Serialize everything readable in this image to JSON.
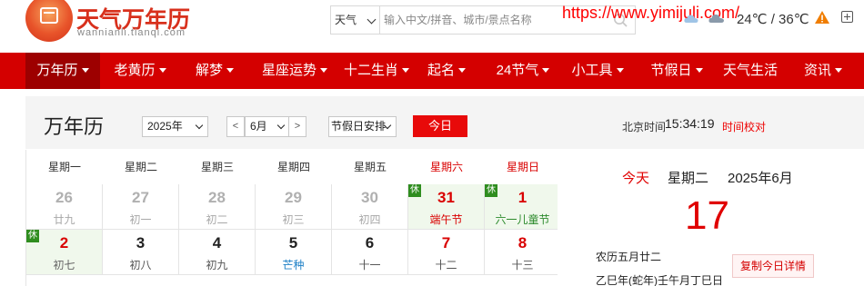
{
  "logo": {
    "title": "天气万年历",
    "subtitle": "wannianli.tianqi.com"
  },
  "search": {
    "type_selected": "天气",
    "placeholder": "输入中文/拼音、城市/景点名称"
  },
  "watermark": "https://www.yimijuli.com/",
  "weather": {
    "temp": "24℃ / 36℃"
  },
  "nav": [
    {
      "label": "万年历",
      "dropdown": true,
      "active": true
    },
    {
      "label": "老黄历",
      "dropdown": true
    },
    {
      "label": "解梦",
      "dropdown": true
    },
    {
      "label": "星座运势",
      "dropdown": true
    },
    {
      "label": "十二生肖",
      "dropdown": true
    },
    {
      "label": "起名",
      "dropdown": true
    },
    {
      "label": "24节气",
      "dropdown": true
    },
    {
      "label": "小工具",
      "dropdown": true
    },
    {
      "label": "节假日",
      "dropdown": true
    },
    {
      "label": "天气生活",
      "dropdown": false
    },
    {
      "label": "资讯",
      "dropdown": true
    }
  ],
  "toolbar": {
    "title": "万年历",
    "year": "2025年",
    "prev": "<",
    "month": "6月",
    "next": ">",
    "holiday": "节假日安排",
    "today": "今日",
    "beijing_label": "北京时间",
    "beijing_time": "15:34:19",
    "calibrate": "时间校对"
  },
  "weekdays": [
    "星期一",
    "星期二",
    "星期三",
    "星期四",
    "星期五",
    "星期六",
    "星期日"
  ],
  "rows": [
    [
      {
        "num": "26",
        "lunar": "廿九",
        "prev": true
      },
      {
        "num": "27",
        "lunar": "初一",
        "prev": true
      },
      {
        "num": "28",
        "lunar": "初二",
        "prev": true
      },
      {
        "num": "29",
        "lunar": "初三",
        "prev": true
      },
      {
        "num": "30",
        "lunar": "初四",
        "prev": true
      },
      {
        "num": "31",
        "lunar": "端午节",
        "holiday": "休",
        "numRed": true,
        "lunarColor": "red"
      },
      {
        "num": "1",
        "lunar": "六一儿童节",
        "holiday": "休",
        "numRed": true,
        "lunarColor": "green"
      }
    ],
    [
      {
        "num": "2",
        "lunar": "初七",
        "holiday": "休",
        "numRed": true,
        "lunarColor": "gray"
      },
      {
        "num": "3",
        "lunar": "初八"
      },
      {
        "num": "4",
        "lunar": "初九"
      },
      {
        "num": "5",
        "lunar": "芒种",
        "lunarColor": "blue"
      },
      {
        "num": "6",
        "lunar": "十一"
      },
      {
        "num": "7",
        "lunar": "十二",
        "numRed": true
      },
      {
        "num": "8",
        "lunar": "十三",
        "numRed": true
      }
    ]
  ],
  "today": {
    "label": "今天",
    "weekday": "星期二",
    "ym": "2025年6月",
    "day": "17",
    "lunar": "农历五月廿二",
    "ganzhi": "乙巳年(蛇年)壬午月丁巳日",
    "copy_button": "复制今日详情"
  }
}
